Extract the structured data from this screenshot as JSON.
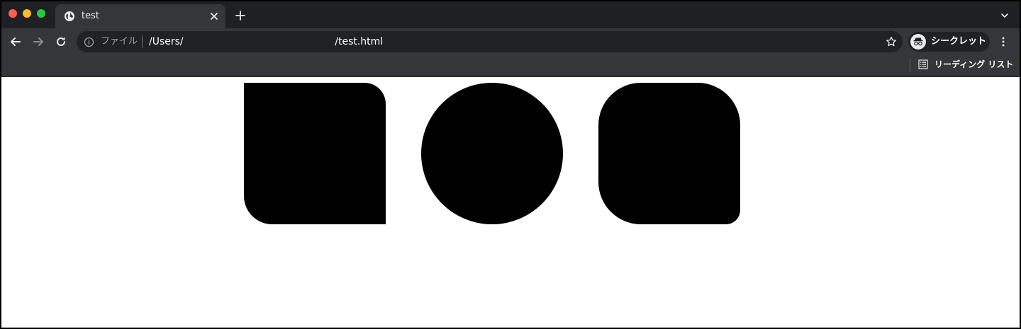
{
  "window": {
    "tab": {
      "title": "test",
      "favicon": "globe-icon"
    }
  },
  "toolbar": {
    "omnibox": {
      "scheme_chip": "ファイル",
      "url": "/Users/                                                /test.html"
    },
    "incognito_label": "シークレット"
  },
  "bookmarks": {
    "reading_list_label": "リーディング リスト"
  },
  "colors": {
    "tab_strip": "#1f2023",
    "toolbar": "#35363a",
    "omnibox": "#202124",
    "page_background": "#ffffff",
    "shape_fill": "#000000"
  },
  "icons": [
    "globe-icon",
    "close-icon",
    "plus-icon",
    "chevron-down-icon",
    "back-arrow-icon",
    "forward-arrow-icon",
    "reload-icon",
    "info-icon",
    "star-icon",
    "incognito-icon",
    "more-vert-icon",
    "reading-list-icon"
  ]
}
